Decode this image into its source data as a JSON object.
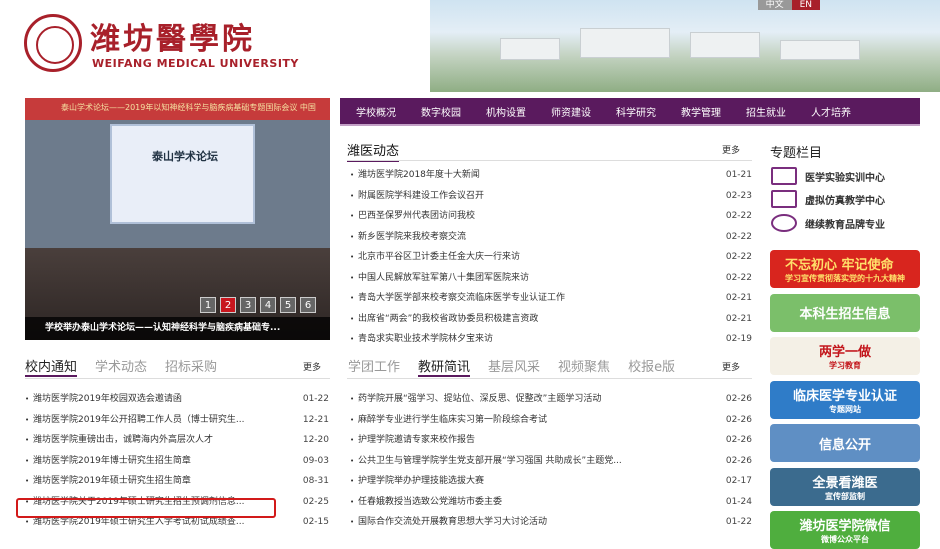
{
  "header": {
    "logo_cn": "潍坊醫學院",
    "logo_en": "WEIFANG MEDICAL UNIVERSITY",
    "lang_cn": "中文",
    "lang_en": "EN"
  },
  "slider": {
    "ticker": "泰山学术论坛——2019年以知神经科学与脑疾病基础专题国际会议   中国",
    "screen_title": "泰山学术论坛",
    "caption": "学校举办泰山学术论坛——认知神经科学与脑疾病基础专...",
    "pages": [
      "1",
      "2",
      "3",
      "4",
      "5",
      "6"
    ],
    "active_page": "2"
  },
  "nav": [
    "学校概况",
    "数字校园",
    "机构设置",
    "师资建设",
    "科学研究",
    "教学管理",
    "招生就业",
    "人才培养"
  ],
  "news_section": {
    "title": "潍医动态",
    "more": "更多",
    "items": [
      {
        "title": "潍坊医学院2018年度十大新闻",
        "date": "01-21"
      },
      {
        "title": "附属医院学科建设工作会议召开",
        "date": "02-23"
      },
      {
        "title": "巴西圣保罗州代表团访问我校",
        "date": "02-22"
      },
      {
        "title": "新乡医学院来我校考察交流",
        "date": "02-22"
      },
      {
        "title": "北京市平谷区卫计委主任金大庆一行来访",
        "date": "02-22"
      },
      {
        "title": "中国人民解放军驻军第八十集团军医院来访",
        "date": "02-22"
      },
      {
        "title": "青岛大学医学部来校考察交流临床医学专业认证工作",
        "date": "02-21"
      },
      {
        "title": "出席省“两会”的我校省政协委员积极建言资政",
        "date": "02-21"
      },
      {
        "title": "青岛求实职业技术学院林夕宝来访",
        "date": "02-19"
      }
    ]
  },
  "notice_section": {
    "tabs": [
      "校内通知",
      "学术动态",
      "招标采购"
    ],
    "more": "更多",
    "items": [
      {
        "title": "潍坊医学院2019年校园双选会邀请函",
        "date": "01-22"
      },
      {
        "title": "潍坊医学院2019年公开招聘工作人员（博士研究生...",
        "date": "12-21"
      },
      {
        "title": "潍坊医学院重磅出击，诚聘海内外高层次人才",
        "date": "12-20"
      },
      {
        "title": "潍坊医学院2019年博士研究生招生简章",
        "date": "09-03"
      },
      {
        "title": "潍坊医学院2019年硕士研究生招生简章",
        "date": "08-31"
      },
      {
        "title": "潍坊医学院关于2019年硕士研究生招生预调剂信息...",
        "date": "02-25"
      },
      {
        "title": "潍坊医学院2019年硕士研究生入学考试初试成绩查...",
        "date": "02-15"
      }
    ]
  },
  "research_section": {
    "tabs": [
      "学团工作",
      "教研简讯",
      "基层风采",
      "视频聚焦",
      "校报e版"
    ],
    "more": "更多",
    "items": [
      {
        "title": "药学院开展“强学习、提站位、深反思、促整改”主题学习活动",
        "date": "02-26"
      },
      {
        "title": "麻醉学专业进行学生临床实习第一阶段综合考试",
        "date": "02-26"
      },
      {
        "title": "护理学院邀请专家来校作报告",
        "date": "02-26"
      },
      {
        "title": "公共卫生与管理学院学生党支部开展“学习强国 共助成长”主题党...",
        "date": "02-26"
      },
      {
        "title": "护理学院举办护理技能选拔大赛",
        "date": "02-17"
      },
      {
        "title": "任春娥教授当选致公党潍坊市委主委",
        "date": "01-24"
      },
      {
        "title": "国际合作交流处开展教育思想大学习大讨论活动",
        "date": "01-22"
      }
    ]
  },
  "special": {
    "title": "专题栏目",
    "items": [
      "医学实验实训中心",
      "虚拟仿真教学中心",
      "继续教育品牌专业"
    ],
    "banners": [
      {
        "text": "不忘初心 牢记使命",
        "sub": "学习宣传贯彻落实党的十九大精神",
        "bg": "#d8251e",
        "fg": "#ffe06a"
      },
      {
        "text": "本科生招生信息",
        "sub": "",
        "bg": "#7bbf6a",
        "fg": "#ffffff"
      },
      {
        "text": "两学一做",
        "sub": "学习教育",
        "bg": "#f4f0e6",
        "fg": "#c3161c"
      },
      {
        "text": "临床医学专业认证",
        "sub": "专题网站",
        "bg": "#2f7cc8",
        "fg": "#ffffff"
      },
      {
        "text": "信息公开",
        "sub": "",
        "bg": "#5f8fc4",
        "fg": "#ffffff"
      },
      {
        "text": "全景看潍医",
        "sub": "宣传部监制",
        "bg": "#3b6b8e",
        "fg": "#ffffff"
      },
      {
        "text": "潍坊医学院微信",
        "sub": "微博公众平台",
        "bg": "#4fae3e",
        "fg": "#ffffff"
      }
    ]
  }
}
